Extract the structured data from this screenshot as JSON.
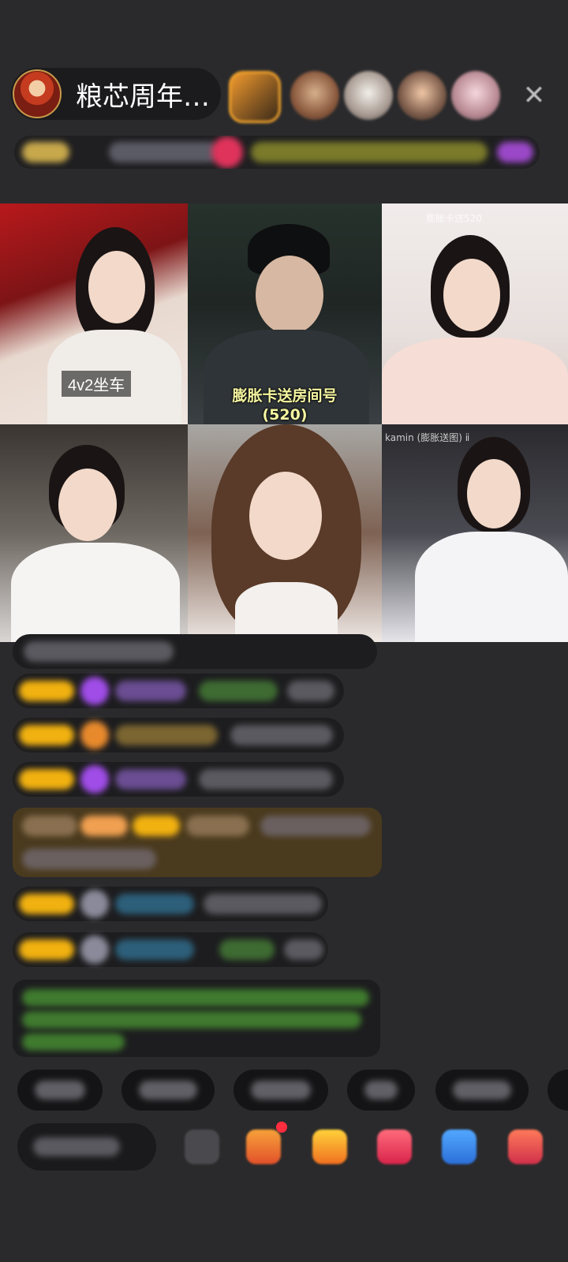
{
  "header": {
    "host_name": "粮芯周年…",
    "close_icon": "close-icon"
  },
  "grid": {
    "tiles": [
      {
        "label": "4v2坐车"
      },
      {
        "caption_line1": "膨胀卡送房间号",
        "caption_line2": "(520)"
      },
      {
        "tag": "膨胀卡送520"
      },
      {},
      {},
      {
        "tag": "kamin (膨胀送图) ⅱ"
      }
    ]
  },
  "icons": {
    "more": "more-icon",
    "gift": "gift-icon",
    "bag": "gift-bag-icon",
    "like": "like-icon",
    "message": "message-icon",
    "apps": "apps-icon"
  },
  "colors": {
    "background": "#2a2a2c",
    "badge": "#f1b110",
    "notification_dot": "#ff2d3d"
  }
}
